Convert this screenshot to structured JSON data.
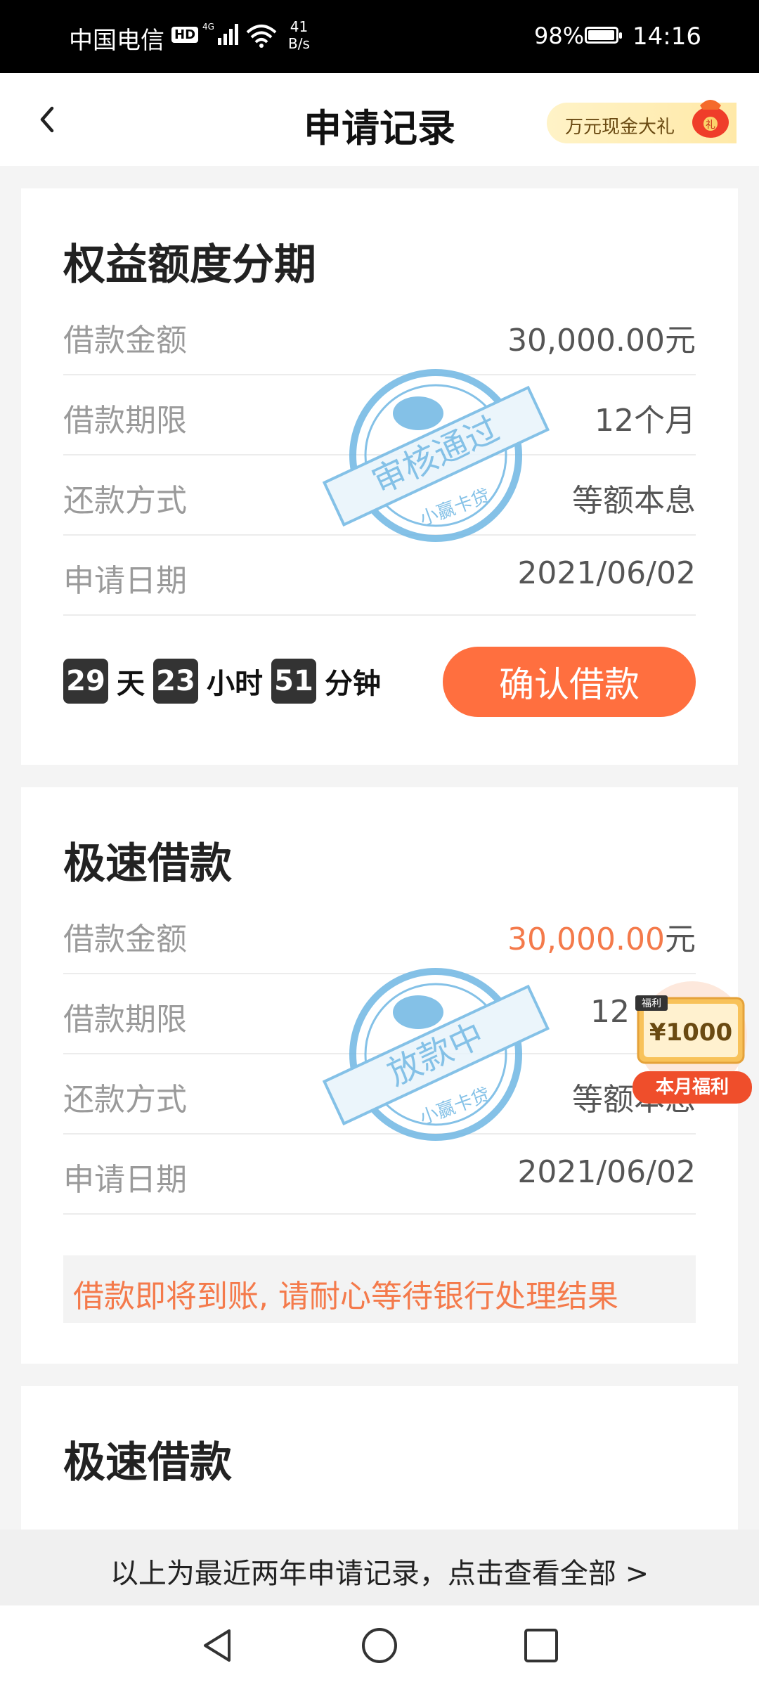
{
  "status_bar": {
    "carrier": "中国电信",
    "hd": "HD",
    "net_speed_value": "41",
    "net_speed_unit": "B/s",
    "battery_pct": "98%",
    "battery_level": 0.98,
    "time": "14:16"
  },
  "header": {
    "title": "申请记录",
    "promo_text": "万元现金大礼",
    "promo_bag_glyph": "礼"
  },
  "cards": [
    {
      "title": "权益额度分期",
      "rows": [
        {
          "label": "借款金额",
          "value": "30,000.00元"
        },
        {
          "label": "借款期限",
          "value": "12个月"
        },
        {
          "label": "还款方式",
          "value": "等额本息"
        },
        {
          "label": "申请日期",
          "value": "2021/06/02"
        }
      ],
      "stamp": {
        "text": "审核通过",
        "brand": "小赢卡贷"
      },
      "countdown": {
        "days": "29",
        "days_unit": "天",
        "hours": "23",
        "hours_unit": "小时",
        "minutes": "51",
        "minutes_unit": "分钟"
      },
      "button": "确认借款"
    },
    {
      "title": "极速借款",
      "rows": [
        {
          "label": "借款金额",
          "amount": "30,000.00",
          "unit": "元"
        },
        {
          "label": "借款期限",
          "value": "12"
        },
        {
          "label": "还款方式",
          "value": "等额本息"
        },
        {
          "label": "申请日期",
          "value": "2021/06/02"
        }
      ],
      "stamp": {
        "text": "放款中",
        "brand": "小赢卡贷"
      },
      "notice": "借款即将到账, 请耐心等待银行处理结果"
    },
    {
      "title": "极速借款"
    }
  ],
  "coupon": {
    "tag": "福利",
    "amount": "¥1000",
    "label": "本月福利"
  },
  "footer": {
    "text": "以上为最近两年申请记录，点击查看全部 >"
  },
  "colors": {
    "accent": "#ff6f3f",
    "highlight": "#f47a4b",
    "stamp": "#6fb7e3"
  },
  "icons": [
    "back-arrow-icon",
    "wifi-icon",
    "signal-icon",
    "battery-icon",
    "nav-back-icon",
    "nav-home-icon",
    "nav-recents-icon"
  ]
}
